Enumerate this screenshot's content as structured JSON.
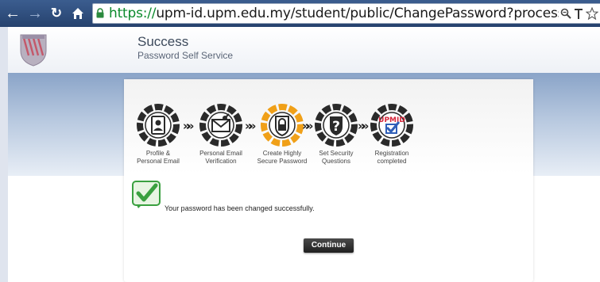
{
  "browser": {
    "url_protocol": "https://",
    "url_rest": "upm-id.upm.edu.my/student/public/ChangePassword?processAction=doChang",
    "icons": [
      "back-icon",
      "forward-icon",
      "reload-icon",
      "home-icon",
      "lock-icon",
      "zoom-icon",
      "font-icon",
      "star-icon"
    ]
  },
  "header": {
    "title": "Success",
    "subtitle": "Password Self Service"
  },
  "steps": [
    {
      "label1": "Profile &",
      "label2": "Personal Email",
      "icon": "profile-icon",
      "highlight": false
    },
    {
      "label1": "Personal Email",
      "label2": "Verification",
      "icon": "envelope-icon",
      "highlight": false
    },
    {
      "label1": "Create Highly",
      "label2": "Secure Password",
      "icon": "lock-icon",
      "highlight": true
    },
    {
      "label1": "Set Security",
      "label2": "Questions",
      "icon": "question-icon",
      "highlight": false
    },
    {
      "label1": "Registration",
      "label2": "completed",
      "icon": "upmid-check-icon",
      "highlight": false
    }
  ],
  "step5_badge": "UPMID",
  "message": "Your password has been changed successfully.",
  "continue_label": "Continue",
  "colors": {
    "highlight_ring": "#f0a018",
    "dark_ring": "#2a2a2a",
    "check_green": "#3aa040"
  }
}
